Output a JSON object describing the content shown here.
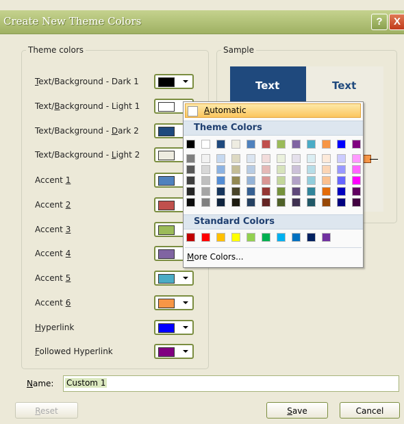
{
  "dialog": {
    "title": "Create New Theme Colors",
    "help_label": "?",
    "close_label": "X"
  },
  "theme_group": {
    "legend": "Theme colors",
    "rows": [
      {
        "pre": "",
        "acc": "T",
        "post": "ext/Background - Dark 1",
        "color": "#000000"
      },
      {
        "pre": "Text/",
        "acc": "B",
        "post": "ackground - Light 1",
        "color": "#ffffff"
      },
      {
        "pre": "Text/Background - ",
        "acc": "D",
        "post": "ark 2",
        "color": "#1f497d"
      },
      {
        "pre": "Text/Background - ",
        "acc": "L",
        "post": "ight 2",
        "color": "#eeece1"
      },
      {
        "pre": "Accent ",
        "acc": "1",
        "post": "",
        "color": "#4f81bd"
      },
      {
        "pre": "Accent ",
        "acc": "2",
        "post": "",
        "color": "#c0504d"
      },
      {
        "pre": "Accent ",
        "acc": "3",
        "post": "",
        "color": "#9bbb59"
      },
      {
        "pre": "Accent ",
        "acc": "4",
        "post": "",
        "color": "#8064a2"
      },
      {
        "pre": "Accent ",
        "acc": "5",
        "post": "",
        "color": "#4bacc6"
      },
      {
        "pre": "Accent ",
        "acc": "6",
        "post": "",
        "color": "#f79646"
      },
      {
        "pre": "",
        "acc": "H",
        "post": "yperlink",
        "color": "#0000ff"
      },
      {
        "pre": "",
        "acc": "F",
        "post": "ollowed Hyperlink",
        "color": "#800080"
      }
    ]
  },
  "sample_group": {
    "legend": "Sample",
    "text_dark": "Text",
    "text_light": "Text"
  },
  "name_field": {
    "label_pre": "",
    "label_acc": "N",
    "label_post": "ame:",
    "value": "Custom 1"
  },
  "buttons": {
    "reset_acc": "R",
    "reset_post": "eset",
    "save_acc": "S",
    "save_post": "ave",
    "cancel": "Cancel"
  },
  "color_popup": {
    "automatic_acc": "A",
    "automatic_post": "utomatic",
    "theme_colors_label": "Theme Colors",
    "standard_colors_label": "Standard Colors",
    "more_acc": "M",
    "more_post": "ore Colors...",
    "theme_columns": [
      {
        "base": "#000000",
        "shades": [
          "#7f7f7f",
          "#595959",
          "#3f3f3f",
          "#262626",
          "#0c0c0c"
        ]
      },
      {
        "base": "#ffffff",
        "shades": [
          "#f2f2f2",
          "#d8d8d8",
          "#bfbfbf",
          "#a5a5a5",
          "#7f7f7f"
        ]
      },
      {
        "base": "#1f497d",
        "shades": [
          "#c6d9f0",
          "#8db3e2",
          "#548dd4",
          "#17365d",
          "#0f243e"
        ]
      },
      {
        "base": "#eeece1",
        "shades": [
          "#ddd9c3",
          "#c4bd97",
          "#938953",
          "#494429",
          "#1d1b10"
        ]
      },
      {
        "base": "#4f81bd",
        "shades": [
          "#dbe5f1",
          "#b8cce4",
          "#95b3d7",
          "#366092",
          "#244061"
        ]
      },
      {
        "base": "#c0504d",
        "shades": [
          "#f2dcdb",
          "#e5b9b7",
          "#d99694",
          "#953734",
          "#632423"
        ]
      },
      {
        "base": "#9bbb59",
        "shades": [
          "#ebf1dd",
          "#d7e3bc",
          "#c3d69b",
          "#76923c",
          "#4f6128"
        ]
      },
      {
        "base": "#8064a2",
        "shades": [
          "#e5e0ec",
          "#ccc1d9",
          "#b2a2c7",
          "#5f497a",
          "#3f3151"
        ]
      },
      {
        "base": "#4bacc6",
        "shades": [
          "#dbeef3",
          "#b7dde8",
          "#92cddc",
          "#31859b",
          "#205867"
        ]
      },
      {
        "base": "#f79646",
        "shades": [
          "#fdeada",
          "#fbd5b5",
          "#fac08f",
          "#e36c09",
          "#974806"
        ]
      },
      {
        "base": "#0000ff",
        "shades": [
          "#ccccff",
          "#9999ff",
          "#6666ff",
          "#0000bf",
          "#00007f"
        ]
      },
      {
        "base": "#800080",
        "shades": [
          "#ff99ff",
          "#ff66ff",
          "#ff00ff",
          "#600060",
          "#400040"
        ]
      }
    ],
    "standard_colors": [
      "#c00000",
      "#ff0000",
      "#ffc000",
      "#ffff00",
      "#92d050",
      "#00b050",
      "#00b0f0",
      "#0070c0",
      "#002060",
      "#7030a0"
    ]
  }
}
